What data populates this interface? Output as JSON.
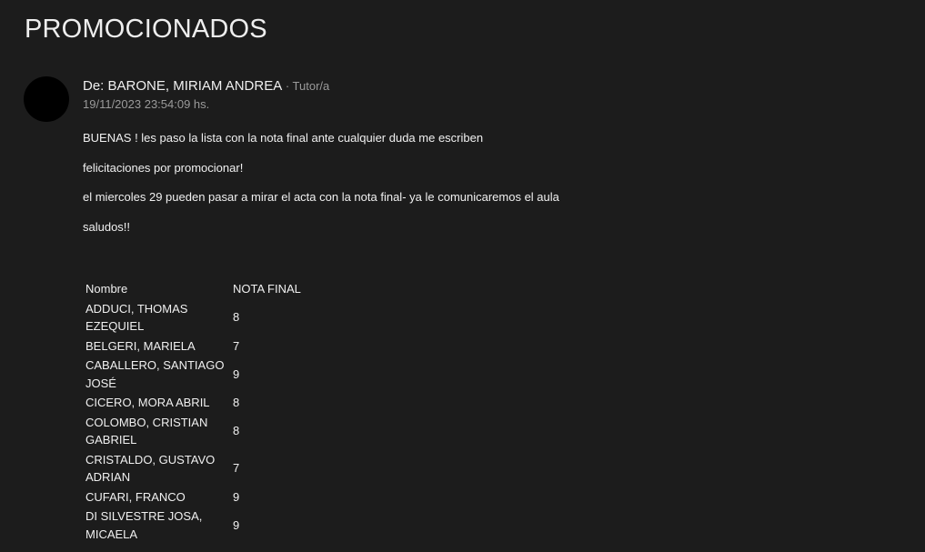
{
  "page_title": "PROMOCIONADOS",
  "post": {
    "from_prefix": "De: ",
    "author": "BARONE, MIRIAM ANDREA",
    "role": " · Tutor/a",
    "timestamp": "19/11/2023 23:54:09 hs.",
    "paragraphs": [
      "BUENAS ! les paso la lista con la nota final ante cualquier duda me escriben",
      "felicitaciones por promocionar!",
      "el miercoles 29 pueden pasar a mirar el acta con la nota final- ya le comunicaremos el aula",
      "saludos!!"
    ]
  },
  "table": {
    "headers": [
      "Nombre",
      "NOTA FINAL"
    ],
    "rows": [
      {
        "name_lines": [
          "ADDUCI, THOMAS",
          "EZEQUIEL"
        ],
        "grade": "8"
      },
      {
        "name_lines": [
          "BELGERI, MARIELA"
        ],
        "grade": "7"
      },
      {
        "name_lines": [
          "CABALLERO, SANTIAGO",
          "JOSÉ"
        ],
        "grade": "9"
      },
      {
        "name_lines": [
          "CICERO, MORA ABRIL"
        ],
        "grade": "8"
      },
      {
        "name_lines": [
          "COLOMBO, CRISTIAN",
          "GABRIEL"
        ],
        "grade": "8"
      },
      {
        "name_lines": [
          "CRISTALDO, GUSTAVO",
          "ADRIAN"
        ],
        "grade": "7"
      },
      {
        "name_lines": [
          "CUFARI, FRANCO"
        ],
        "grade": "9"
      },
      {
        "name_lines": [
          "DI SILVESTRE JOSA,",
          "MICAELA"
        ],
        "grade": "9"
      }
    ]
  }
}
